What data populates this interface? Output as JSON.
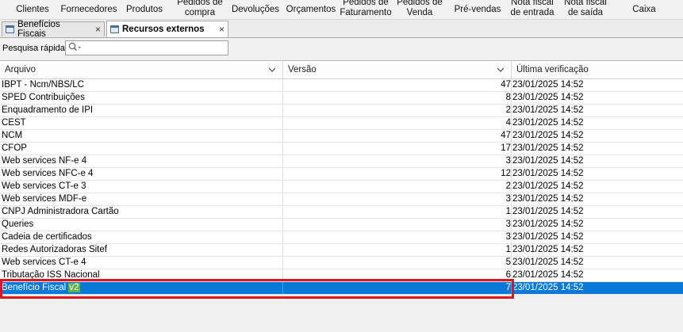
{
  "menu": [
    {
      "label": "Clientes"
    },
    {
      "label": "Fornecedores"
    },
    {
      "label": "Produtos"
    },
    {
      "label": "Pedidos de\ncompra"
    },
    {
      "label": "Devoluções"
    },
    {
      "label": "Orçamentos"
    },
    {
      "label": "Pedidos de\nFaturamento"
    },
    {
      "label": "Pedidos de\nVenda"
    },
    {
      "label": "Pré-vendas"
    },
    {
      "label": "Nota fiscal\nde entrada"
    },
    {
      "label": "Nota fiscal\nde saída"
    },
    {
      "label": "Caixa"
    }
  ],
  "tabs": [
    {
      "label": "Benefícios Fiscais",
      "close": "×"
    },
    {
      "label": "Recursos externos",
      "close": "×"
    }
  ],
  "search": {
    "label": "Pesquisa rápida:",
    "value": "",
    "placeholder": ""
  },
  "columns": {
    "arquivo": "Arquivo",
    "versao": "Versão",
    "ultima": "Última verificação"
  },
  "rows": [
    {
      "name": "IBPT - Ncm/NBS/LC",
      "version": "47",
      "date": "23/01/2025 14:52"
    },
    {
      "name": "SPED Contribuições",
      "version": "8",
      "date": "23/01/2025 14:52"
    },
    {
      "name": "Enquadramento de IPI",
      "version": "2",
      "date": "23/01/2025 14:52"
    },
    {
      "name": "CEST",
      "version": "4",
      "date": "23/01/2025 14:52"
    },
    {
      "name": "NCM",
      "version": "47",
      "date": "23/01/2025 14:52"
    },
    {
      "name": "CFOP",
      "version": "17",
      "date": "23/01/2025 14:52"
    },
    {
      "name": "Web services NF-e 4",
      "version": "3",
      "date": "23/01/2025 14:52"
    },
    {
      "name": "Web services NFC-e 4",
      "version": "12",
      "date": "23/01/2025 14:52"
    },
    {
      "name": "Web services CT-e 3",
      "version": "2",
      "date": "23/01/2025 14:52"
    },
    {
      "name": "Web services MDF-e",
      "version": "3",
      "date": "23/01/2025 14:52"
    },
    {
      "name": "CNPJ Administradora Cartão",
      "version": "1",
      "date": "23/01/2025 14:52"
    },
    {
      "name": "Queries",
      "version": "3",
      "date": "23/01/2025 14:52"
    },
    {
      "name": "Cadeia de certificados",
      "version": "3",
      "date": "23/01/2025 14:52"
    },
    {
      "name": "Redes Autorizadoras Sitef",
      "version": "1",
      "date": "23/01/2025 14:52"
    },
    {
      "name": "Web services CT-e 4",
      "version": "5",
      "date": "23/01/2025 14:52"
    },
    {
      "name": "Tributação ISS Nacional",
      "version": "6",
      "date": "23/01/2025 14:52"
    }
  ],
  "selected_row": {
    "name": "Benefício Fiscal",
    "name_suffix": "v2",
    "version": "7",
    "date": "23/01/2025 14:52"
  },
  "colors": {
    "selection": "#0a78d7",
    "annotation": "#e0141e",
    "highlight": "#5fb04f"
  }
}
